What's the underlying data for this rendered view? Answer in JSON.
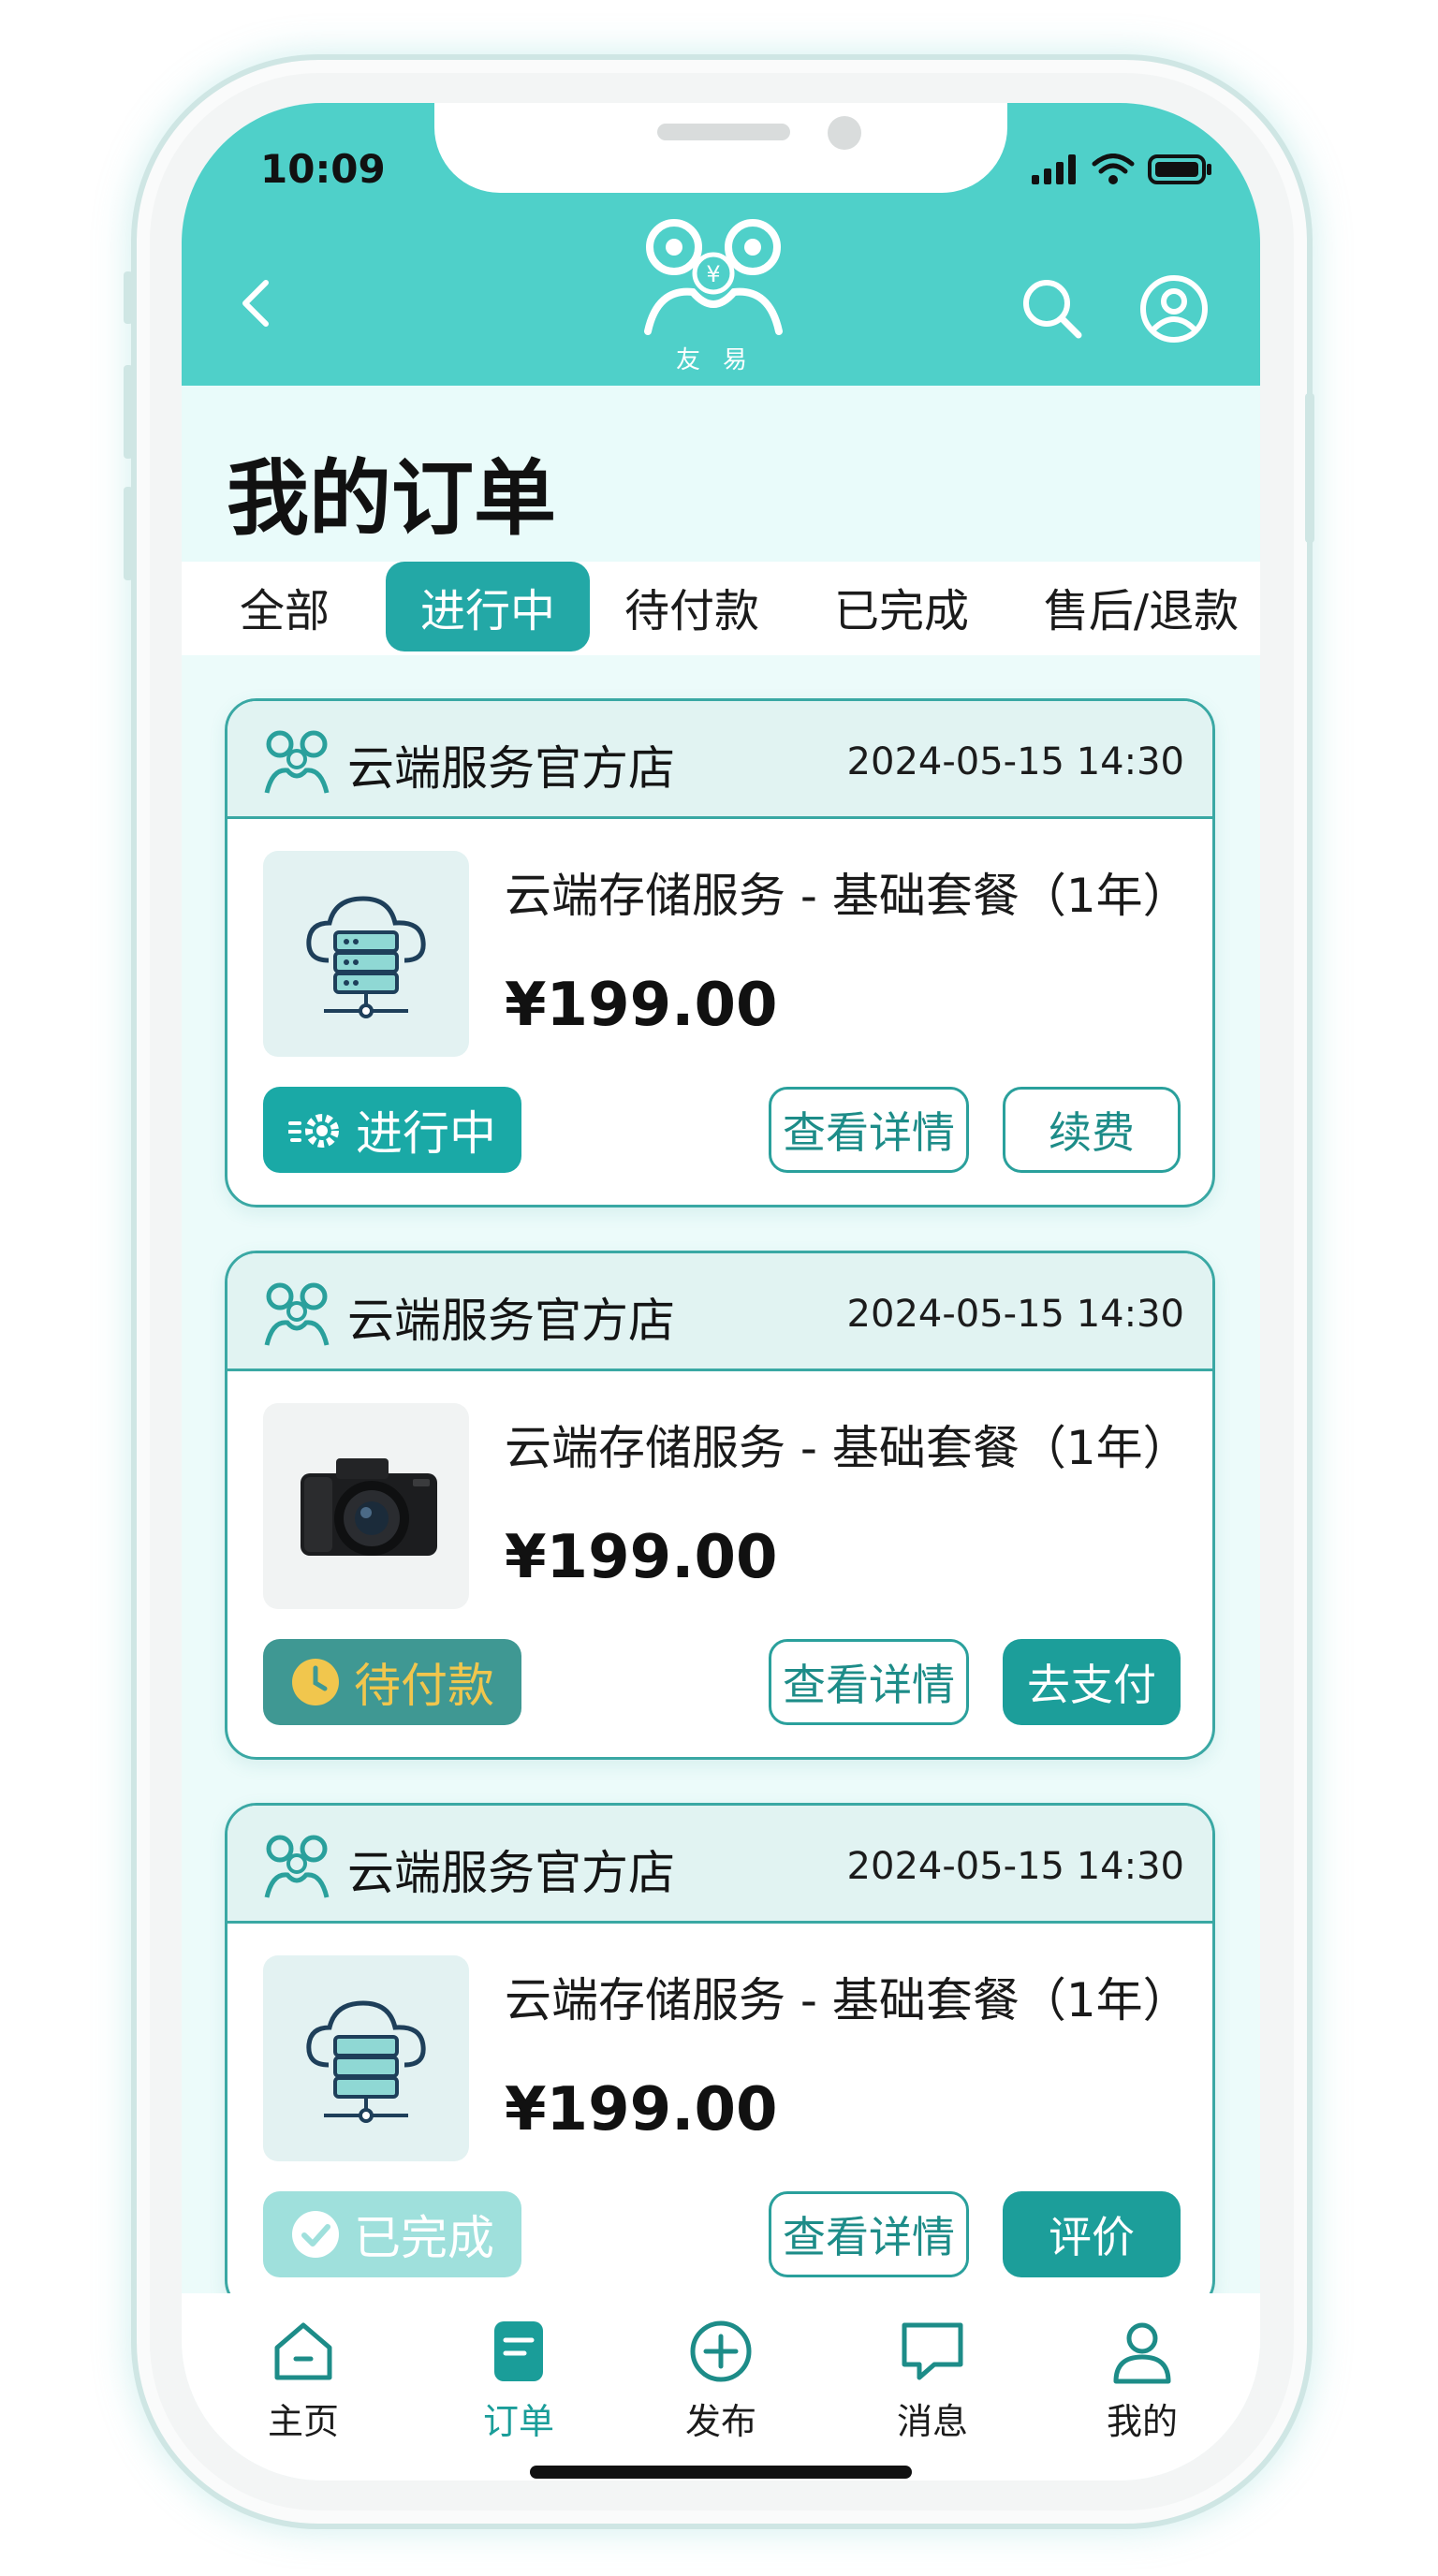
{
  "status_bar": {
    "time": "10:09"
  },
  "header": {
    "logo_text": "友易",
    "logo_symbol": "¥"
  },
  "page": {
    "title": "我的订单"
  },
  "tabs": [
    {
      "label": "全部",
      "active": false
    },
    {
      "label": "进行中",
      "active": true
    },
    {
      "label": "待付款",
      "active": false
    },
    {
      "label": "已完成",
      "active": false
    },
    {
      "label": "售后/退款",
      "active": false
    }
  ],
  "orders": [
    {
      "shop": "云端服务官方店",
      "time": "2024-05-15 14:30",
      "product": "云端存储服务 - 基础套餐（1年）",
      "price": "¥199.00",
      "thumbnail": "cloud-server-icon",
      "status": "进行中",
      "detail_label": "查看详情",
      "action_label": "续费"
    },
    {
      "shop": "云端服务官方店",
      "time": "2024-05-15 14:30",
      "product": "云端存储服务 - 基础套餐（1年）",
      "price": "¥199.00",
      "thumbnail": "camera-photo",
      "status": "待付款",
      "detail_label": "查看详情",
      "action_label": "去支付"
    },
    {
      "shop": "云端服务官方店",
      "time": "2024-05-15 14:30",
      "product": "云端存储服务 - 基础套餐（1年）",
      "price": "¥199.00",
      "thumbnail": "cloud-server-icon",
      "status": "已完成",
      "detail_label": "查看详情",
      "action_label": "评价"
    }
  ],
  "bottom_nav": [
    {
      "label": "主页",
      "icon": "home-icon",
      "active": false
    },
    {
      "label": "订单",
      "icon": "order-icon",
      "active": true
    },
    {
      "label": "发布",
      "icon": "plus-circle-icon",
      "active": false
    },
    {
      "label": "消息",
      "icon": "message-icon",
      "active": false
    },
    {
      "label": "我的",
      "icon": "person-icon",
      "active": false
    }
  ],
  "colors": {
    "header": "#4fd0c9",
    "accent": "#1c9e9a",
    "background": "#ecfbfa",
    "pending": "#f1c64d"
  }
}
